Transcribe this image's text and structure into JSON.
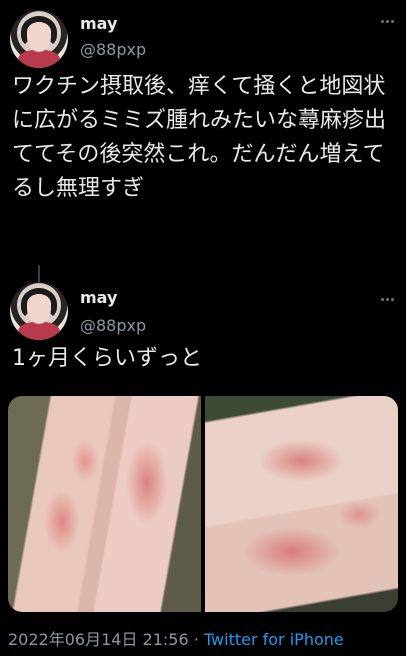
{
  "tweets": [
    {
      "name": "may",
      "handle": "@88pxp",
      "text": "ワクチン摂取後、痒くて掻くと地図状に広がるミミズ腫れみたいな蕁麻疹出ててその後突然これ。だんだん増えてるし無理すぎ"
    },
    {
      "name": "may",
      "handle": "@88pxp",
      "text": "1ヶ月くらいずっと",
      "media": [
        {
          "alt": "rash on legs photo"
        },
        {
          "alt": "rash on thigh photo"
        }
      ],
      "timestamp": "2022年06月14日 21:56",
      "separator": "·",
      "source": "Twitter for iPhone"
    }
  ]
}
